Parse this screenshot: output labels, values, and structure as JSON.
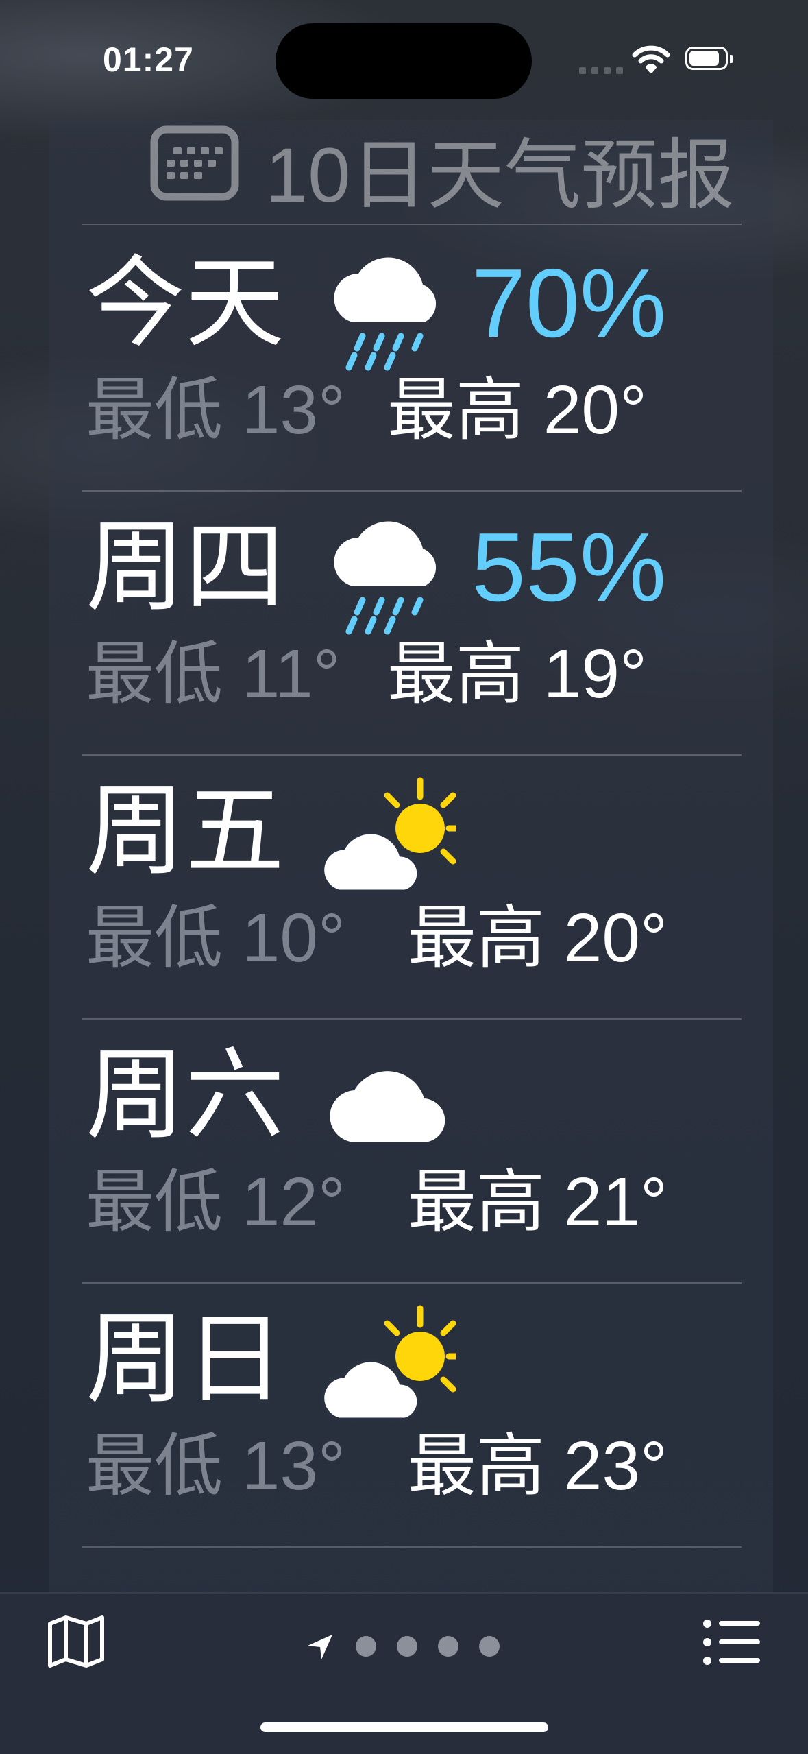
{
  "status_bar": {
    "time": "01:27",
    "battery_level": 0.85,
    "signal_icon": "cellular-signal-icon",
    "wifi_icon": "wifi-icon",
    "battery_icon": "battery-icon"
  },
  "forecast": {
    "title": "10日天气预报",
    "header_icon": "calendar-icon",
    "days": [
      {
        "day": "今天",
        "icon": "rain-icon",
        "precip": "70%",
        "low": "最低 13°",
        "high": "最高 20°"
      },
      {
        "day": "周四",
        "icon": "rain-icon",
        "precip": "55%",
        "low": "最低 11°",
        "high": "最高 19°"
      },
      {
        "day": "周五",
        "icon": "partly-sunny-icon",
        "precip": "",
        "low": "最低 10°",
        "high": "最高 20°"
      },
      {
        "day": "周六",
        "icon": "cloud-icon",
        "precip": "",
        "low": "最低 12°",
        "high": "最高 21°"
      },
      {
        "day": "周日",
        "icon": "partly-sunny-icon",
        "precip": "",
        "low": "最低 13°",
        "high": "最高 23°"
      }
    ]
  },
  "bottom_bar": {
    "map_icon": "map-icon",
    "location_icon": "location-arrow-icon",
    "page_count": 4,
    "current_page": 0,
    "list_icon": "list-icon"
  },
  "colors": {
    "precip": "#63cdfb",
    "low": "#7d838e",
    "sun": "#ffd60a"
  }
}
